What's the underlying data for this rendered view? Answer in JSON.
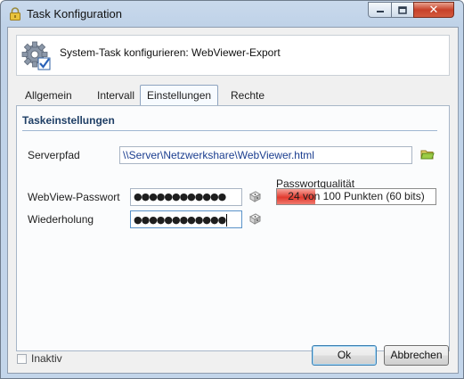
{
  "window": {
    "title": "Task Konfiguration",
    "close_glyph": "✕"
  },
  "header": {
    "text": "System-Task konfigurieren: WebViewer-Export",
    "icon": "gear-check-icon"
  },
  "tabs": [
    {
      "label": "Allgemein",
      "active": false
    },
    {
      "label": "Intervall",
      "active": false
    },
    {
      "label": "Einstellungen",
      "active": true
    },
    {
      "label": "Rechte",
      "active": false
    }
  ],
  "section": {
    "title": "Taskeinstellungen"
  },
  "server": {
    "label": "Serverpfad",
    "value": "\\\\Server\\Netzwerkshare\\WebViewer.html",
    "browse_icon": "folder-browse-icon"
  },
  "password": {
    "label": "WebView-Passwort",
    "masked_value": "●●●●●●●●●●●●",
    "generate_icon": "dice-icon"
  },
  "repeat": {
    "label": "Wiederholung",
    "masked_value": "●●●●●●●●●●●●",
    "generate_icon": "dice-icon"
  },
  "quality": {
    "label": "Passwortqualität",
    "text": "24 von 100 Punkten (60 bits)",
    "score": 24,
    "max": 100,
    "bar_color": "#e13a2e"
  },
  "footer": {
    "inactive_label": "Inaktiv",
    "inactive_checked": false,
    "ok_label": "Ok",
    "cancel_label": "Abbrechen"
  },
  "colors": {
    "section_title": "#1f3f66",
    "window_frame": "#c3d5ea"
  }
}
